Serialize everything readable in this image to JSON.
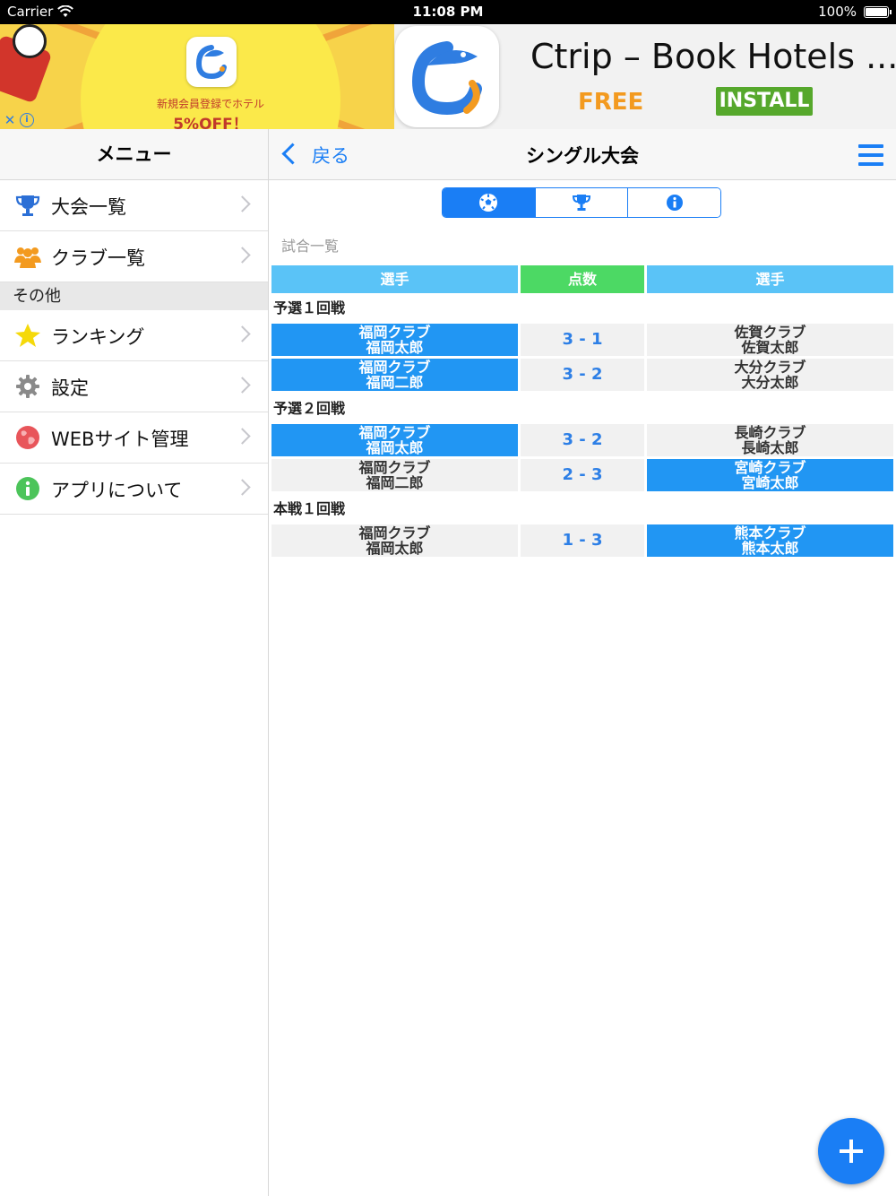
{
  "status_bar": {
    "carrier": "Carrier",
    "time": "11:08 PM",
    "battery": "100%"
  },
  "ad": {
    "promo_line1": "新規会員登録でホテル",
    "promo_line2": "5%OFF！",
    "app_title": "Ctrip – Book Hotels ...",
    "price": "FREE",
    "install_label": "INSTALL"
  },
  "sidebar": {
    "title": "メニュー",
    "items": [
      {
        "label": "大会一覧",
        "icon": "trophy-icon"
      },
      {
        "label": "クラブ一覧",
        "icon": "users-icon"
      }
    ],
    "section_label": "その他",
    "other_items": [
      {
        "label": "ランキング",
        "icon": "star-icon"
      },
      {
        "label": "設定",
        "icon": "gear-icon"
      },
      {
        "label": "WEBサイト管理",
        "icon": "globe-icon"
      },
      {
        "label": "アプリについて",
        "icon": "info-icon"
      }
    ]
  },
  "navbar": {
    "back_label": "戻る",
    "title": "シングル大会"
  },
  "segment": {
    "tabs": [
      "soccer-ball-icon",
      "trophy-icon",
      "info-icon"
    ],
    "selected": 0
  },
  "list_caption": "試合一覧",
  "table": {
    "headers": {
      "player1": "選手",
      "score": "点数",
      "player2": "選手"
    },
    "rounds": [
      {
        "name": "予選１回戦",
        "matches": [
          {
            "p1_club": "福岡クラブ",
            "p1_name": "福岡太郎",
            "score": "3 - 1",
            "p2_club": "佐賀クラブ",
            "p2_name": "佐賀太郎",
            "winner": 1
          },
          {
            "p1_club": "福岡クラブ",
            "p1_name": "福岡二郎",
            "score": "3 - 2",
            "p2_club": "大分クラブ",
            "p2_name": "大分太郎",
            "winner": 1
          }
        ]
      },
      {
        "name": "予選２回戦",
        "matches": [
          {
            "p1_club": "福岡クラブ",
            "p1_name": "福岡太郎",
            "score": "3 - 2",
            "p2_club": "長崎クラブ",
            "p2_name": "長崎太郎",
            "winner": 1
          },
          {
            "p1_club": "福岡クラブ",
            "p1_name": "福岡二郎",
            "score": "2 - 3",
            "p2_club": "宮崎クラブ",
            "p2_name": "宮崎太郎",
            "winner": 2
          }
        ]
      },
      {
        "name": "本戦１回戦",
        "matches": [
          {
            "p1_club": "福岡クラブ",
            "p1_name": "福岡太郎",
            "score": "1 - 3",
            "p2_club": "熊本クラブ",
            "p2_name": "熊本太郎",
            "winner": 2
          }
        ]
      }
    ]
  },
  "colors": {
    "accent": "#1a7ef5",
    "winner_bg": "#2196f3",
    "header_player": "#5ac3f7",
    "header_score": "#4cd964"
  }
}
